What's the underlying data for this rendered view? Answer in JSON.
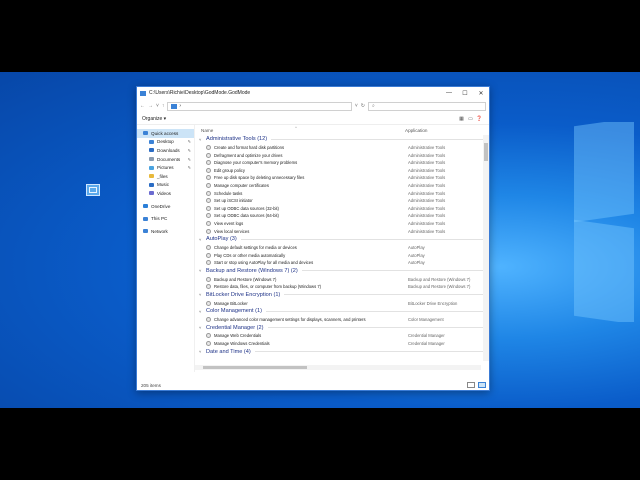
{
  "window": {
    "title": "C:\\Users\\Richie\\Desktop\\GodMode.GodMode",
    "minimize": "—",
    "maximize": "☐",
    "close": "✕"
  },
  "address": {
    "path": "›",
    "back": "←",
    "forward": "→",
    "recent": "˅",
    "up": "↑",
    "dropdown": "˅",
    "refresh": "↻",
    "search_icon": "⌕"
  },
  "toolbar": {
    "organize_label": "Organize ▾"
  },
  "nav": {
    "items": [
      {
        "label": "Quick access",
        "icon": "star-icon",
        "color": "#3b82d6",
        "selected": true,
        "sub": false
      },
      {
        "label": "Desktop",
        "icon": "desktop-icon",
        "color": "#3b82d6",
        "selected": false,
        "sub": true,
        "pinned": true
      },
      {
        "label": "Downloads",
        "icon": "downloads-icon",
        "color": "#2b6cc4",
        "selected": false,
        "sub": true,
        "pinned": true
      },
      {
        "label": "Documents",
        "icon": "documents-icon",
        "color": "#8a9bb0",
        "selected": false,
        "sub": true,
        "pinned": true
      },
      {
        "label": "Pictures",
        "icon": "pictures-icon",
        "color": "#4aa3e0",
        "selected": false,
        "sub": true,
        "pinned": true
      },
      {
        "label": "_files",
        "icon": "folder-icon",
        "color": "#e8b93c",
        "selected": false,
        "sub": true,
        "pinned": false
      },
      {
        "label": "Music",
        "icon": "music-icon",
        "color": "#2b6cc4",
        "selected": false,
        "sub": true,
        "pinned": false
      },
      {
        "label": "Videos",
        "icon": "videos-icon",
        "color": "#6b6bd0",
        "selected": false,
        "sub": true,
        "pinned": false
      },
      {
        "label": "OneDrive",
        "icon": "onedrive-icon",
        "color": "#2b7fd8",
        "selected": false,
        "sub": false,
        "gap": true
      },
      {
        "label": "This PC",
        "icon": "computer-icon",
        "color": "#3b82d6",
        "selected": false,
        "sub": false,
        "gap": true
      },
      {
        "label": "Network",
        "icon": "network-icon",
        "color": "#3b82d6",
        "selected": false,
        "sub": false,
        "gap": true
      }
    ]
  },
  "columns": {
    "name": "Name",
    "application": "Application",
    "sort_indicator": "^"
  },
  "groups": [
    {
      "title": "Administrative Tools (12)",
      "items": [
        {
          "name": "Create and format hard disk partitions",
          "app": "Administrative Tools"
        },
        {
          "name": "Defragment and optimize your drives",
          "app": "Administrative Tools"
        },
        {
          "name": "Diagnose your computer's memory problems",
          "app": "Administrative Tools"
        },
        {
          "name": "Edit group policy",
          "app": "Administrative Tools"
        },
        {
          "name": "Free up disk space by deleting unnecessary files",
          "app": "Administrative Tools"
        },
        {
          "name": "Manage computer certificates",
          "app": "Administrative Tools"
        },
        {
          "name": "Schedule tasks",
          "app": "Administrative Tools"
        },
        {
          "name": "Set up iSCSI initiator",
          "app": "Administrative Tools"
        },
        {
          "name": "Set up ODBC data sources (32-bit)",
          "app": "Administrative Tools"
        },
        {
          "name": "Set up ODBC data sources (64-bit)",
          "app": "Administrative Tools"
        },
        {
          "name": "View event logs",
          "app": "Administrative Tools"
        },
        {
          "name": "View local services",
          "app": "Administrative Tools"
        }
      ]
    },
    {
      "title": "AutoPlay (3)",
      "items": [
        {
          "name": "Change default settings for media or devices",
          "app": "AutoPlay"
        },
        {
          "name": "Play CDs or other media automatically",
          "app": "AutoPlay"
        },
        {
          "name": "Start or stop using AutoPlay for all media and devices",
          "app": "AutoPlay"
        }
      ]
    },
    {
      "title": "Backup and Restore (Windows 7) (2)",
      "items": [
        {
          "name": "Backup and Restore (Windows 7)",
          "app": "Backup and Restore (Windows 7)"
        },
        {
          "name": "Restore data, files, or computer from backup (Windows 7)",
          "app": "Backup and Restore (Windows 7)"
        }
      ]
    },
    {
      "title": "BitLocker Drive Encryption (1)",
      "items": [
        {
          "name": "Manage BitLocker",
          "app": "BitLocker Drive Encryption"
        }
      ]
    },
    {
      "title": "Color Management (1)",
      "items": [
        {
          "name": "Change advanced color management settings for displays, scanners, and printers",
          "app": "Color Management"
        }
      ]
    },
    {
      "title": "Credential Manager (2)",
      "items": [
        {
          "name": "Manage Web Credentials",
          "app": "Credential Manager"
        },
        {
          "name": "Manage Windows Credentials",
          "app": "Credential Manager"
        }
      ]
    },
    {
      "title": "Date and Time (4)",
      "items": []
    }
  ],
  "status": {
    "count": "205 items"
  }
}
